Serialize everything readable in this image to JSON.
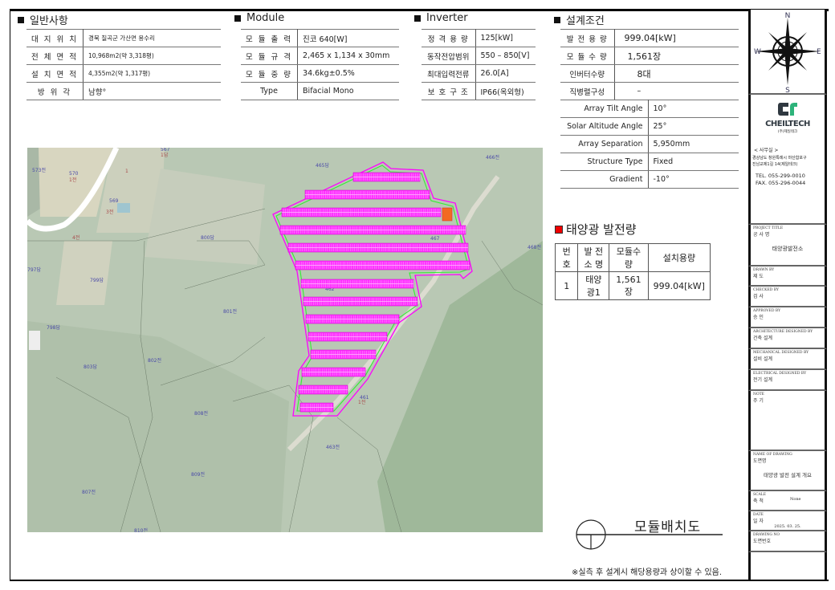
{
  "general": {
    "title": "일반사항",
    "rows": [
      {
        "label": "대 지 위 치",
        "value": "경북 칠곡군 가산면 용수리"
      },
      {
        "label": "전 체 면 적",
        "value": "10,968m2(약 3,318평)"
      },
      {
        "label": "설 치 면 적",
        "value": "4,355m2(약 1,317평)"
      },
      {
        "label": "방   위   각",
        "value": "남향°"
      }
    ]
  },
  "module": {
    "title": "Module",
    "rows": [
      {
        "label": "모 듈 출 력",
        "value": "진코 640[W]"
      },
      {
        "label": "모 듈 규 격",
        "value": "2,465 x 1,134 x 30mm"
      },
      {
        "label": "모 듈 중 량",
        "value": "34.6kg±0.5%"
      },
      {
        "label": "Type",
        "value": "Bifacial Mono"
      }
    ]
  },
  "inverter": {
    "title": "Inverter",
    "rows": [
      {
        "label": "정 격 용 량",
        "value": "125[kW]"
      },
      {
        "label": "동작전압범위",
        "value": "550 – 850[V]"
      },
      {
        "label": "최대입력전류",
        "value": "26.0[A]"
      },
      {
        "label": "보 호 구 조",
        "value": "IP66(옥외형)"
      }
    ]
  },
  "design": {
    "title": "설계조건",
    "rows": [
      {
        "label": "발 전 용 량",
        "value": "999.04[kW]"
      },
      {
        "label": "모 듈 수 량",
        "value": "1,561장"
      },
      {
        "label": "인버터수량",
        "value": "8대"
      },
      {
        "label": "직병렬구성",
        "value": "–"
      }
    ],
    "rows2": [
      {
        "label": "Array Tilt Angle",
        "value": "10°"
      },
      {
        "label": "Solar Altitude Angle",
        "value": "25°"
      },
      {
        "label": "Array Separation",
        "value": "5,950mm"
      },
      {
        "label": "Structure Type",
        "value": "Fixed"
      },
      {
        "label": "Gradient",
        "value": "-10°"
      }
    ]
  },
  "generation": {
    "title": "태양광 발전량",
    "headers": [
      "번 호",
      "발 전 소 명",
      "모듈수량",
      "설치용량"
    ],
    "rows": [
      [
        "1",
        "태양광1",
        "1,561장",
        "999.04[kW]"
      ]
    ]
  },
  "drawing_title": "모듈배치도",
  "footnote": "※실측 후 설계시 해당용량과 상이할 수 있음.",
  "map": {
    "labels": [
      {
        "t": "573전"
      },
      {
        "t": "570"
      },
      {
        "t": "1전",
        "red": true
      },
      {
        "t": "569"
      },
      {
        "t": "3전",
        "red": true
      },
      {
        "t": "4전",
        "red": true
      },
      {
        "t": "567"
      },
      {
        "t": "1답",
        "red": true
      },
      {
        "t": "1",
        "red": true
      },
      {
        "t": "800답"
      },
      {
        "t": "799답"
      },
      {
        "t": "797답"
      },
      {
        "t": "798답"
      },
      {
        "t": "801전"
      },
      {
        "t": "803답"
      },
      {
        "t": "802전"
      },
      {
        "t": "808전"
      },
      {
        "t": "809전"
      },
      {
        "t": "807전"
      },
      {
        "t": "810전"
      },
      {
        "t": "465답"
      },
      {
        "t": "466전"
      },
      {
        "t": "468전"
      },
      {
        "t": "467"
      },
      {
        "t": "462"
      },
      {
        "t": "461"
      },
      {
        "t": "1전",
        "red": true
      },
      {
        "t": "463전"
      }
    ],
    "colors": {
      "boundary": "#ff00ff",
      "inner": "#33ee33",
      "panels": "#ff33ff",
      "inverter": "#f26a22"
    }
  },
  "titleblock": {
    "compass": {
      "n": "N",
      "s": "S",
      "e": "E",
      "w": "W"
    },
    "company": "CHEILTECH",
    "company_kr": "(주)제일테크",
    "office": "< 사무실 >",
    "address1": "경상남도 창원특례시 마산합포구",
    "address2": "진남교제1길 14(제일테크)",
    "tel": "TEL. 055-299-0010",
    "fax": "FAX. 055-296-0044",
    "project_cap": "PROJECT TITLE",
    "project_kr": "공 사 명",
    "project": "태양광발전소",
    "drawn_cap": "DRAWN BY",
    "drawn_kr": "제 도",
    "checked_cap": "CHECKED BY",
    "checked_kr": "검 사",
    "approved_cap": "APPROVED BY",
    "approved_kr": "승 인",
    "arch_cap": "ARCHITECTURE DESIGNED BY",
    "arch_kr": "건축 설계",
    "mech_cap": "MECHANICAL DESIGNED BY",
    "mech_kr": "설비 설계",
    "elec_cap": "ELECTRICAL DESIGNED BY",
    "elec_kr": "전기 설계",
    "note_cap": "NOTE",
    "note_kr": "주 기",
    "name_cap": "NAME OF DRAWING",
    "name_kr": "도면명",
    "name": "태양광 발전 설계 개요",
    "scale_cap": "SCALE",
    "scale_kr": "축 척",
    "scale": "None",
    "date_cap": "DATE",
    "date_kr": "일 자",
    "date": "2025. 03. 25.",
    "no_cap": "DRAWING NO",
    "no_kr": "도면번호"
  }
}
